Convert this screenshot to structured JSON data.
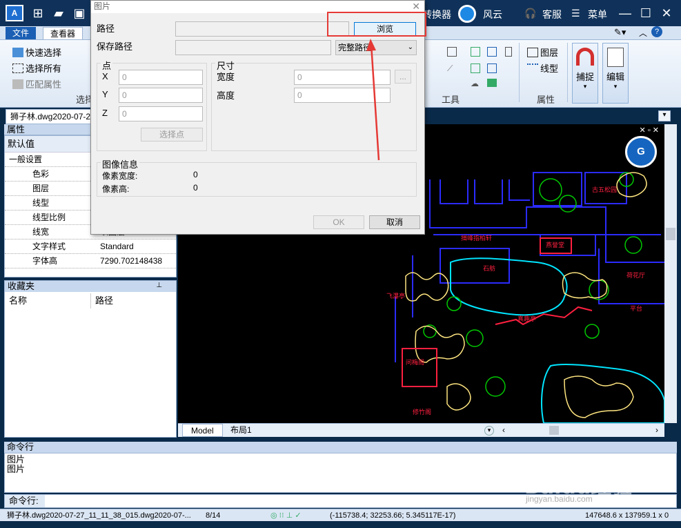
{
  "titlebar": {
    "converter_label": "转换器",
    "fengyun_label": "风云",
    "service_label": "客服",
    "menu_label": "菜单"
  },
  "ribbon": {
    "tabs": [
      "文件",
      "查看器"
    ],
    "select_group": {
      "quick_select": "快速选择",
      "select_all": "选择所有",
      "match_props": "匹配属性",
      "label": "选择"
    },
    "tools_label": "工具",
    "layer_label": "图层",
    "linetype_label": "线型",
    "props_label": "属性",
    "snap_label": "捕捉",
    "edit_label": "编辑"
  },
  "doc_tab": "狮子林.dwg2020-07-27",
  "properties": {
    "header": "属性",
    "default_value": "默认值",
    "section": "一般设置",
    "rows": [
      {
        "key": "色彩",
        "value": ""
      },
      {
        "key": "图层",
        "value": ""
      },
      {
        "key": "线型",
        "value": ""
      },
      {
        "key": "线型比例",
        "value": ""
      },
      {
        "key": "线宽",
        "value": "以图层"
      },
      {
        "key": "文字样式",
        "value": "Standard"
      },
      {
        "key": "字体高",
        "value": "7290.702148438"
      }
    ]
  },
  "favorites": {
    "header": "收藏夹",
    "col_name": "名称",
    "col_path": "路径"
  },
  "canvas": {
    "model_tab": "Model",
    "layout_tab": "布局1",
    "labels": [
      "石舫",
      "古五松园",
      "燕誉堂",
      "揖峰指柏轩",
      "飞瀑亭",
      "问梅阁",
      "荷花厅",
      "平台",
      "真趣亭",
      "修竹阁"
    ]
  },
  "command": {
    "header": "命令行",
    "output_lines": [
      "图片",
      "图片"
    ],
    "input_label": "命令行:"
  },
  "status": {
    "filename": "狮子林.dwg2020-07-27_11_11_38_015.dwg2020-07-...",
    "page": "8/14",
    "coords": "(-115738.4; 32253.66; 5.345117E-17)",
    "extent": "147648.6 x 137959.1 x 0"
  },
  "dialog": {
    "title": "图片",
    "path_label": "路径",
    "save_path_label": "保存路径",
    "browse_label": "浏览",
    "save_path_option": "完整路径",
    "point_group": "点",
    "x_label": "X",
    "y_label": "Y",
    "z_label": "Z",
    "x_value": "0",
    "y_value": "0",
    "z_value": "0",
    "select_point": "选择点",
    "size_group": "尺寸",
    "width_label": "宽度",
    "height_label": "高度",
    "width_value": "0",
    "height_value": "0",
    "ellipsis": "...",
    "image_info_group": "图像信息",
    "pixel_width_label": "像素宽度:",
    "pixel_width_value": "0",
    "pixel_height_label": "像素高:",
    "pixel_height_value": "0",
    "ok_label": "OK",
    "cancel_label": "取消"
  },
  "watermark": {
    "text": "Baidu经验",
    "sub": "jingyan.baidu.com"
  },
  "colors": {
    "annotation": "#e53935",
    "titlebar": "#10325a",
    "ribbon_active_tab": "#1b5fb4",
    "cad_blue": "#2b2bff",
    "cad_green": "#00c800",
    "cad_cyan": "#00e5ff",
    "cad_yellow": "#ffe680",
    "cad_red": "#ff2040"
  }
}
